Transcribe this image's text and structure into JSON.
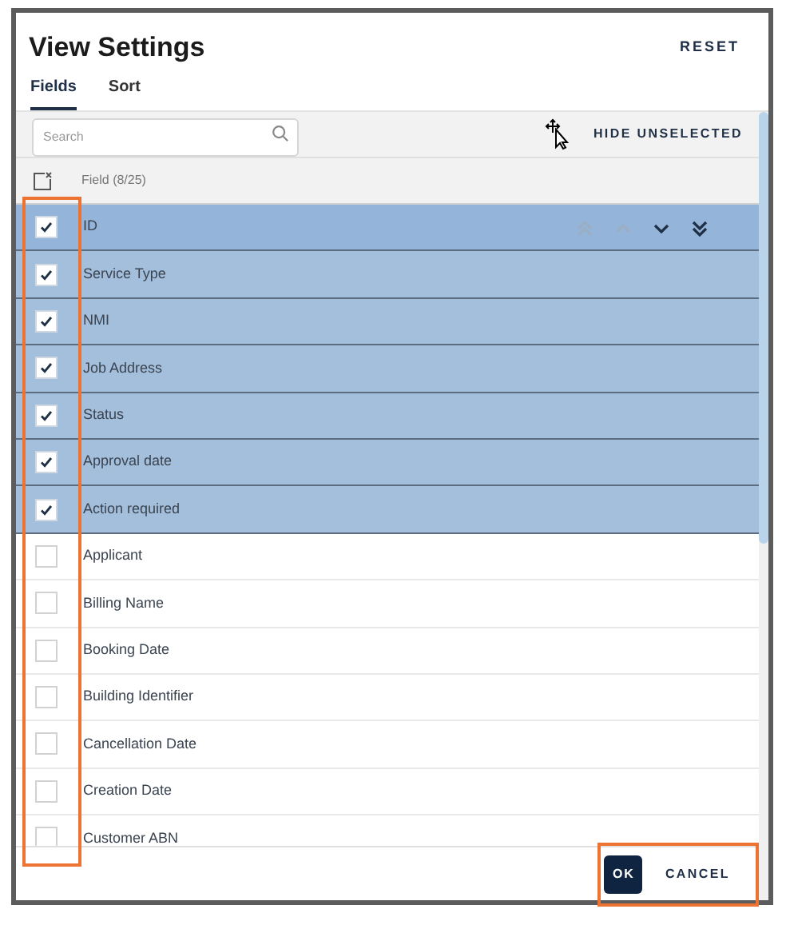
{
  "dialog": {
    "title": "View Settings",
    "reset": "RESET"
  },
  "tabs": [
    {
      "label": "Fields",
      "selected": true
    },
    {
      "label": "Sort",
      "selected": false
    }
  ],
  "search": {
    "placeholder": "Search"
  },
  "hide_unselected": "HIDE UNSELECTED",
  "field_header": "Field (8/25)",
  "move_buttons": [
    {
      "kind": "top",
      "disabled": true
    },
    {
      "kind": "up",
      "disabled": true
    },
    {
      "kind": "down",
      "disabled": false
    },
    {
      "kind": "bottom",
      "disabled": false
    }
  ],
  "fields": [
    {
      "label": "ID",
      "checked": true,
      "hovered": true
    },
    {
      "label": "Service Type",
      "checked": true,
      "hovered": false
    },
    {
      "label": "NMI",
      "checked": true,
      "hovered": false
    },
    {
      "label": "Job Address",
      "checked": true,
      "hovered": false
    },
    {
      "label": "Status",
      "checked": true,
      "hovered": false
    },
    {
      "label": "Approval date",
      "checked": true,
      "hovered": false
    },
    {
      "label": "Action required",
      "checked": true,
      "hovered": false
    },
    {
      "label": "Applicant",
      "checked": false,
      "hovered": false
    },
    {
      "label": "Billing Name",
      "checked": false,
      "hovered": false
    },
    {
      "label": "Booking Date",
      "checked": false,
      "hovered": false
    },
    {
      "label": "Building Identifier",
      "checked": false,
      "hovered": false
    },
    {
      "label": "Cancellation Date",
      "checked": false,
      "hovered": false
    },
    {
      "label": "Creation Date",
      "checked": false,
      "hovered": false
    },
    {
      "label": "Customer ABN",
      "checked": false,
      "hovered": false
    }
  ],
  "buttons": [
    {
      "kind": "primary",
      "label": "OK"
    },
    {
      "kind": "text",
      "label": "CANCEL"
    }
  ]
}
